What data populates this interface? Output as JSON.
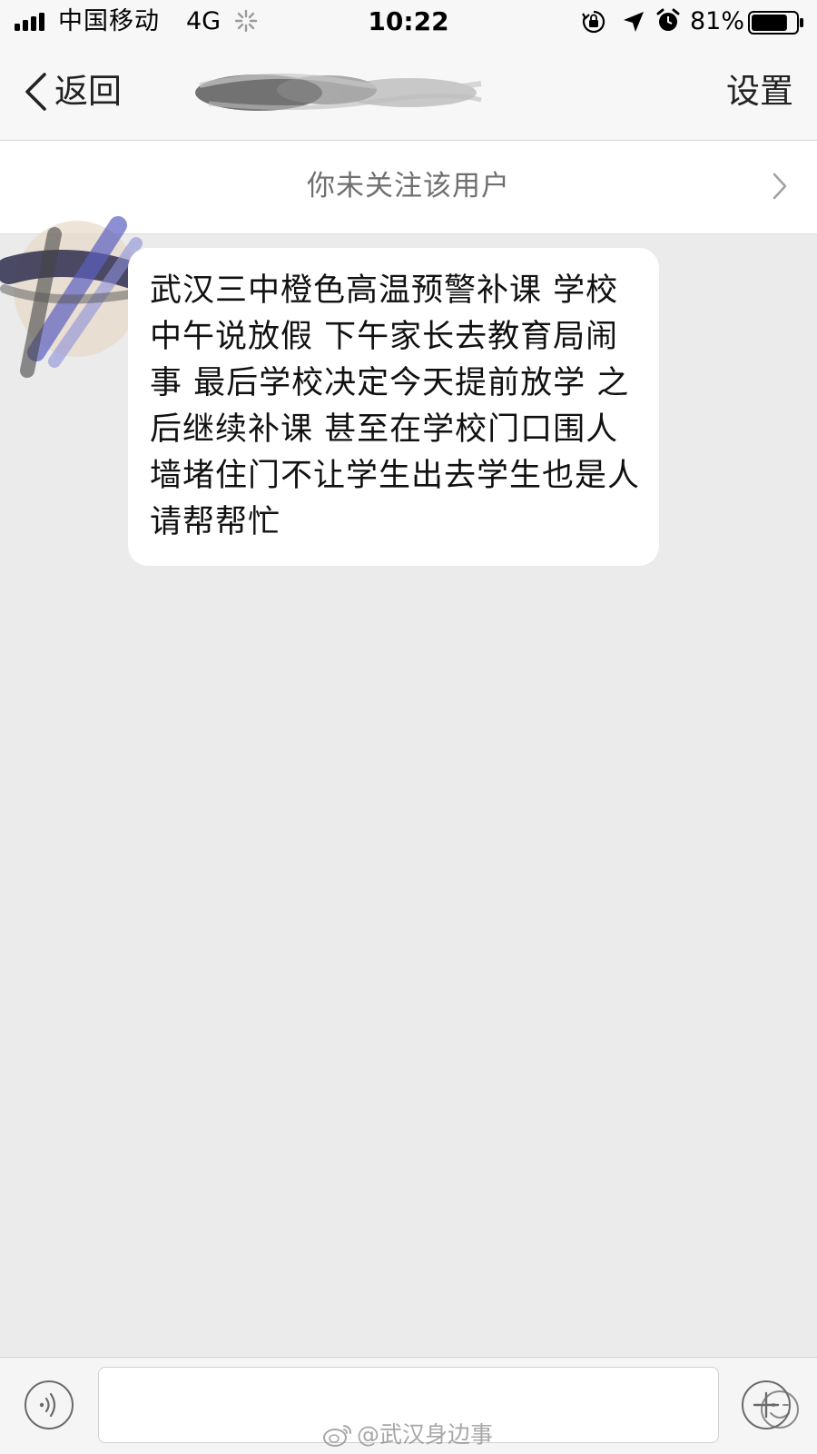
{
  "status_bar": {
    "carrier": "中国移动",
    "network": "4G",
    "time": "10:22",
    "battery_percent": "81%",
    "battery_level": 0.81,
    "icons": [
      "signal-bars-icon",
      "loading-spinner-icon",
      "orientation-lock-icon",
      "location-arrow-icon",
      "alarm-clock-icon",
      "battery-icon"
    ]
  },
  "nav": {
    "back_label": "返回",
    "settings_label": "设置"
  },
  "follow_notice": {
    "text": "你未关注该用户"
  },
  "message": {
    "text": "武汉三中橙色高温预警补课 学校中午说放假 下午家长去教育局闹事 最后学校决定今天提前放学 之后继续补课 甚至在学校门口围人墙堵住门不让学生出去学生也是人 请帮帮忙"
  },
  "input_bar": {
    "placeholder": "",
    "icons": [
      "voice-icon",
      "emoji-icon",
      "plus-icon"
    ]
  },
  "watermark": {
    "text": "@武汉身边事"
  },
  "colors": {
    "background": "#ebebeb",
    "bar": "#f7f7f7",
    "bubble": "#ffffff",
    "notice_text": "#6f6f6f"
  }
}
